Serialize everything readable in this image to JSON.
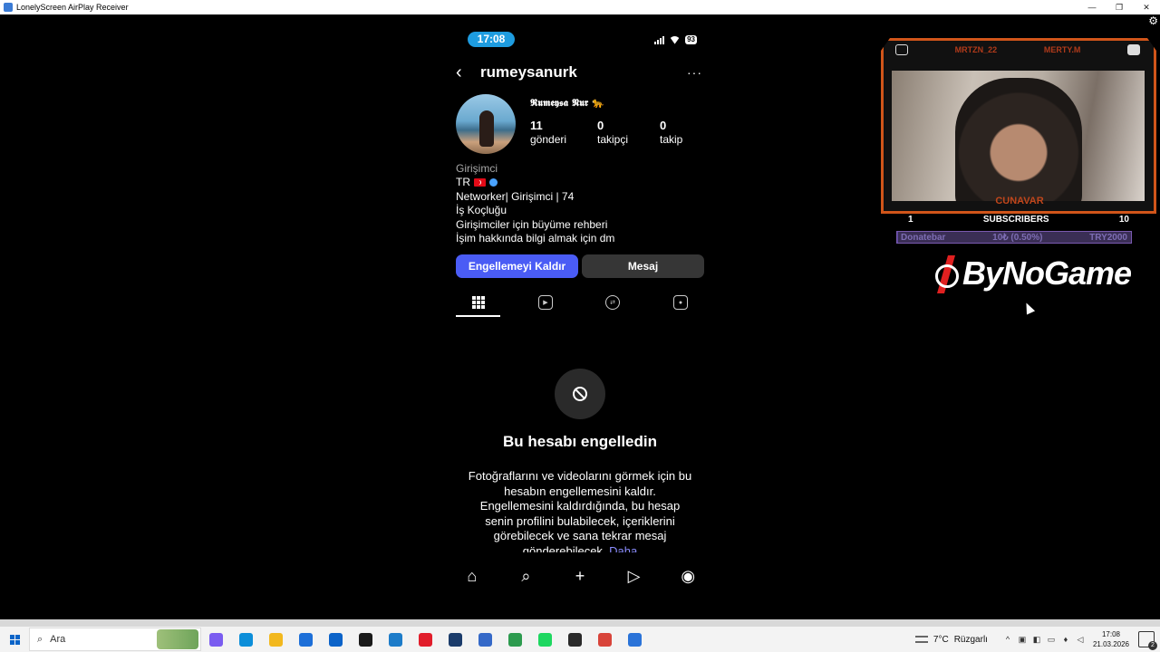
{
  "window": {
    "title": "LonelyScreen AirPlay Receiver",
    "controls": [
      "—",
      "❐",
      "✕"
    ]
  },
  "phone": {
    "status": {
      "time": "17:08",
      "battery": "93"
    },
    "header": {
      "username": "rumeysanurk",
      "more": "···"
    },
    "profile": {
      "display_name": "𝕽𝖚𝖒𝖊𝖞𝖘𝖆 𝕹𝖚𝖗 🐆",
      "stats": [
        {
          "value": "11",
          "label": "gönderi"
        },
        {
          "value": "0",
          "label": "takipçi"
        },
        {
          "value": "0",
          "label": "takip"
        }
      ],
      "category": "Girişimci",
      "bio_country": "TR",
      "bio_lines": [
        "Networker| Girişimci | 74",
        "İş Koçluğu",
        "Girişimciler için büyüme rehberi",
        "İşim hakkında bilgi almak için dm"
      ]
    },
    "buttons": {
      "unblock": "Engellemeyi Kaldır",
      "message": "Mesaj"
    },
    "tabs": [
      "grid-icon",
      "reels-icon",
      "repost-icon",
      "tagged-icon"
    ],
    "blocked": {
      "title": "Bu hesabı engelledin",
      "description": "Fotoğraflarını ve videolarını görmek için bu hesabın engellemesini kaldır. Engellemesini kaldırdığında, bu hesap senin profilini bulabilecek, içeriklerini görebilecek ve sana tekrar mesaj gönderebilecek.",
      "more": "Daha"
    },
    "bottom_nav": [
      "home-icon",
      "search-icon",
      "create-icon",
      "reels-icon",
      "profile-icon"
    ]
  },
  "overlay": {
    "socials": [
      {
        "icon": "instagram-icon",
        "name": "MRTZN_22"
      },
      {
        "icon": "youtube-icon",
        "name": "MERTY.M"
      }
    ],
    "cam_name": "CUNAVAR",
    "subscribers": {
      "current": "1",
      "label": "SUBSCRIBERS",
      "goal": "10",
      "fill": 0.1
    },
    "donate": {
      "label": "Donatebar",
      "value": "10₺ (0.50%)",
      "goal": "TRY2000",
      "fill": 0.005
    },
    "brand": "ByNoGame"
  },
  "taskbar": {
    "search_placeholder": "Ara",
    "apps": [
      {
        "name": "copilot-icon",
        "color": "#7a5cf0"
      },
      {
        "name": "edge-icon",
        "color": "#0c8ed9"
      },
      {
        "name": "explorer-icon",
        "color": "#f2b81e"
      },
      {
        "name": "store-icon",
        "color": "#1d6fd8"
      },
      {
        "name": "mail-icon",
        "color": "#0b63c9"
      },
      {
        "name": "security-icon",
        "color": "#1a1a1a"
      },
      {
        "name": "vscode-icon",
        "color": "#1d7cc9"
      },
      {
        "name": "opera-icon",
        "color": "#e11d2b"
      },
      {
        "name": "steam-icon",
        "color": "#1b3c6b"
      },
      {
        "name": "app-icon",
        "color": "#3569c8"
      },
      {
        "name": "chrome-icon",
        "color": "#2d9b4f"
      },
      {
        "name": "spotify-icon",
        "color": "#1ed760"
      },
      {
        "name": "obs-icon",
        "color": "#2a2a2a"
      },
      {
        "name": "chrome-icon-2",
        "color": "#d8443a"
      },
      {
        "name": "airplay-icon",
        "color": "#2a73d8"
      }
    ],
    "weather": {
      "temp": "7°C",
      "text": "Rüzgarlı"
    },
    "clock": {
      "time": "17:08",
      "date": "21.03.2026"
    },
    "notifications": "2"
  }
}
